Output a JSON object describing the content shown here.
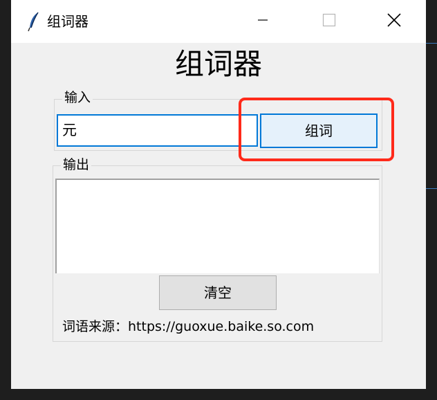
{
  "window": {
    "title": "组词器",
    "app_title": "组词器"
  },
  "input_group": {
    "label": "输入",
    "value": "元",
    "button_label": "组词"
  },
  "output_group": {
    "label": "输出",
    "text": "",
    "clear_label": "清空",
    "source_label": "词语来源：https://guoxue.baike.so.com"
  },
  "colors": {
    "accent": "#0078d7",
    "highlight": "#ff2a1a",
    "window_bg": "#f0f0f0"
  },
  "icons": {
    "app": "feather-icon",
    "minimize": "minimize-icon",
    "maximize": "maximize-icon",
    "close": "close-icon"
  }
}
